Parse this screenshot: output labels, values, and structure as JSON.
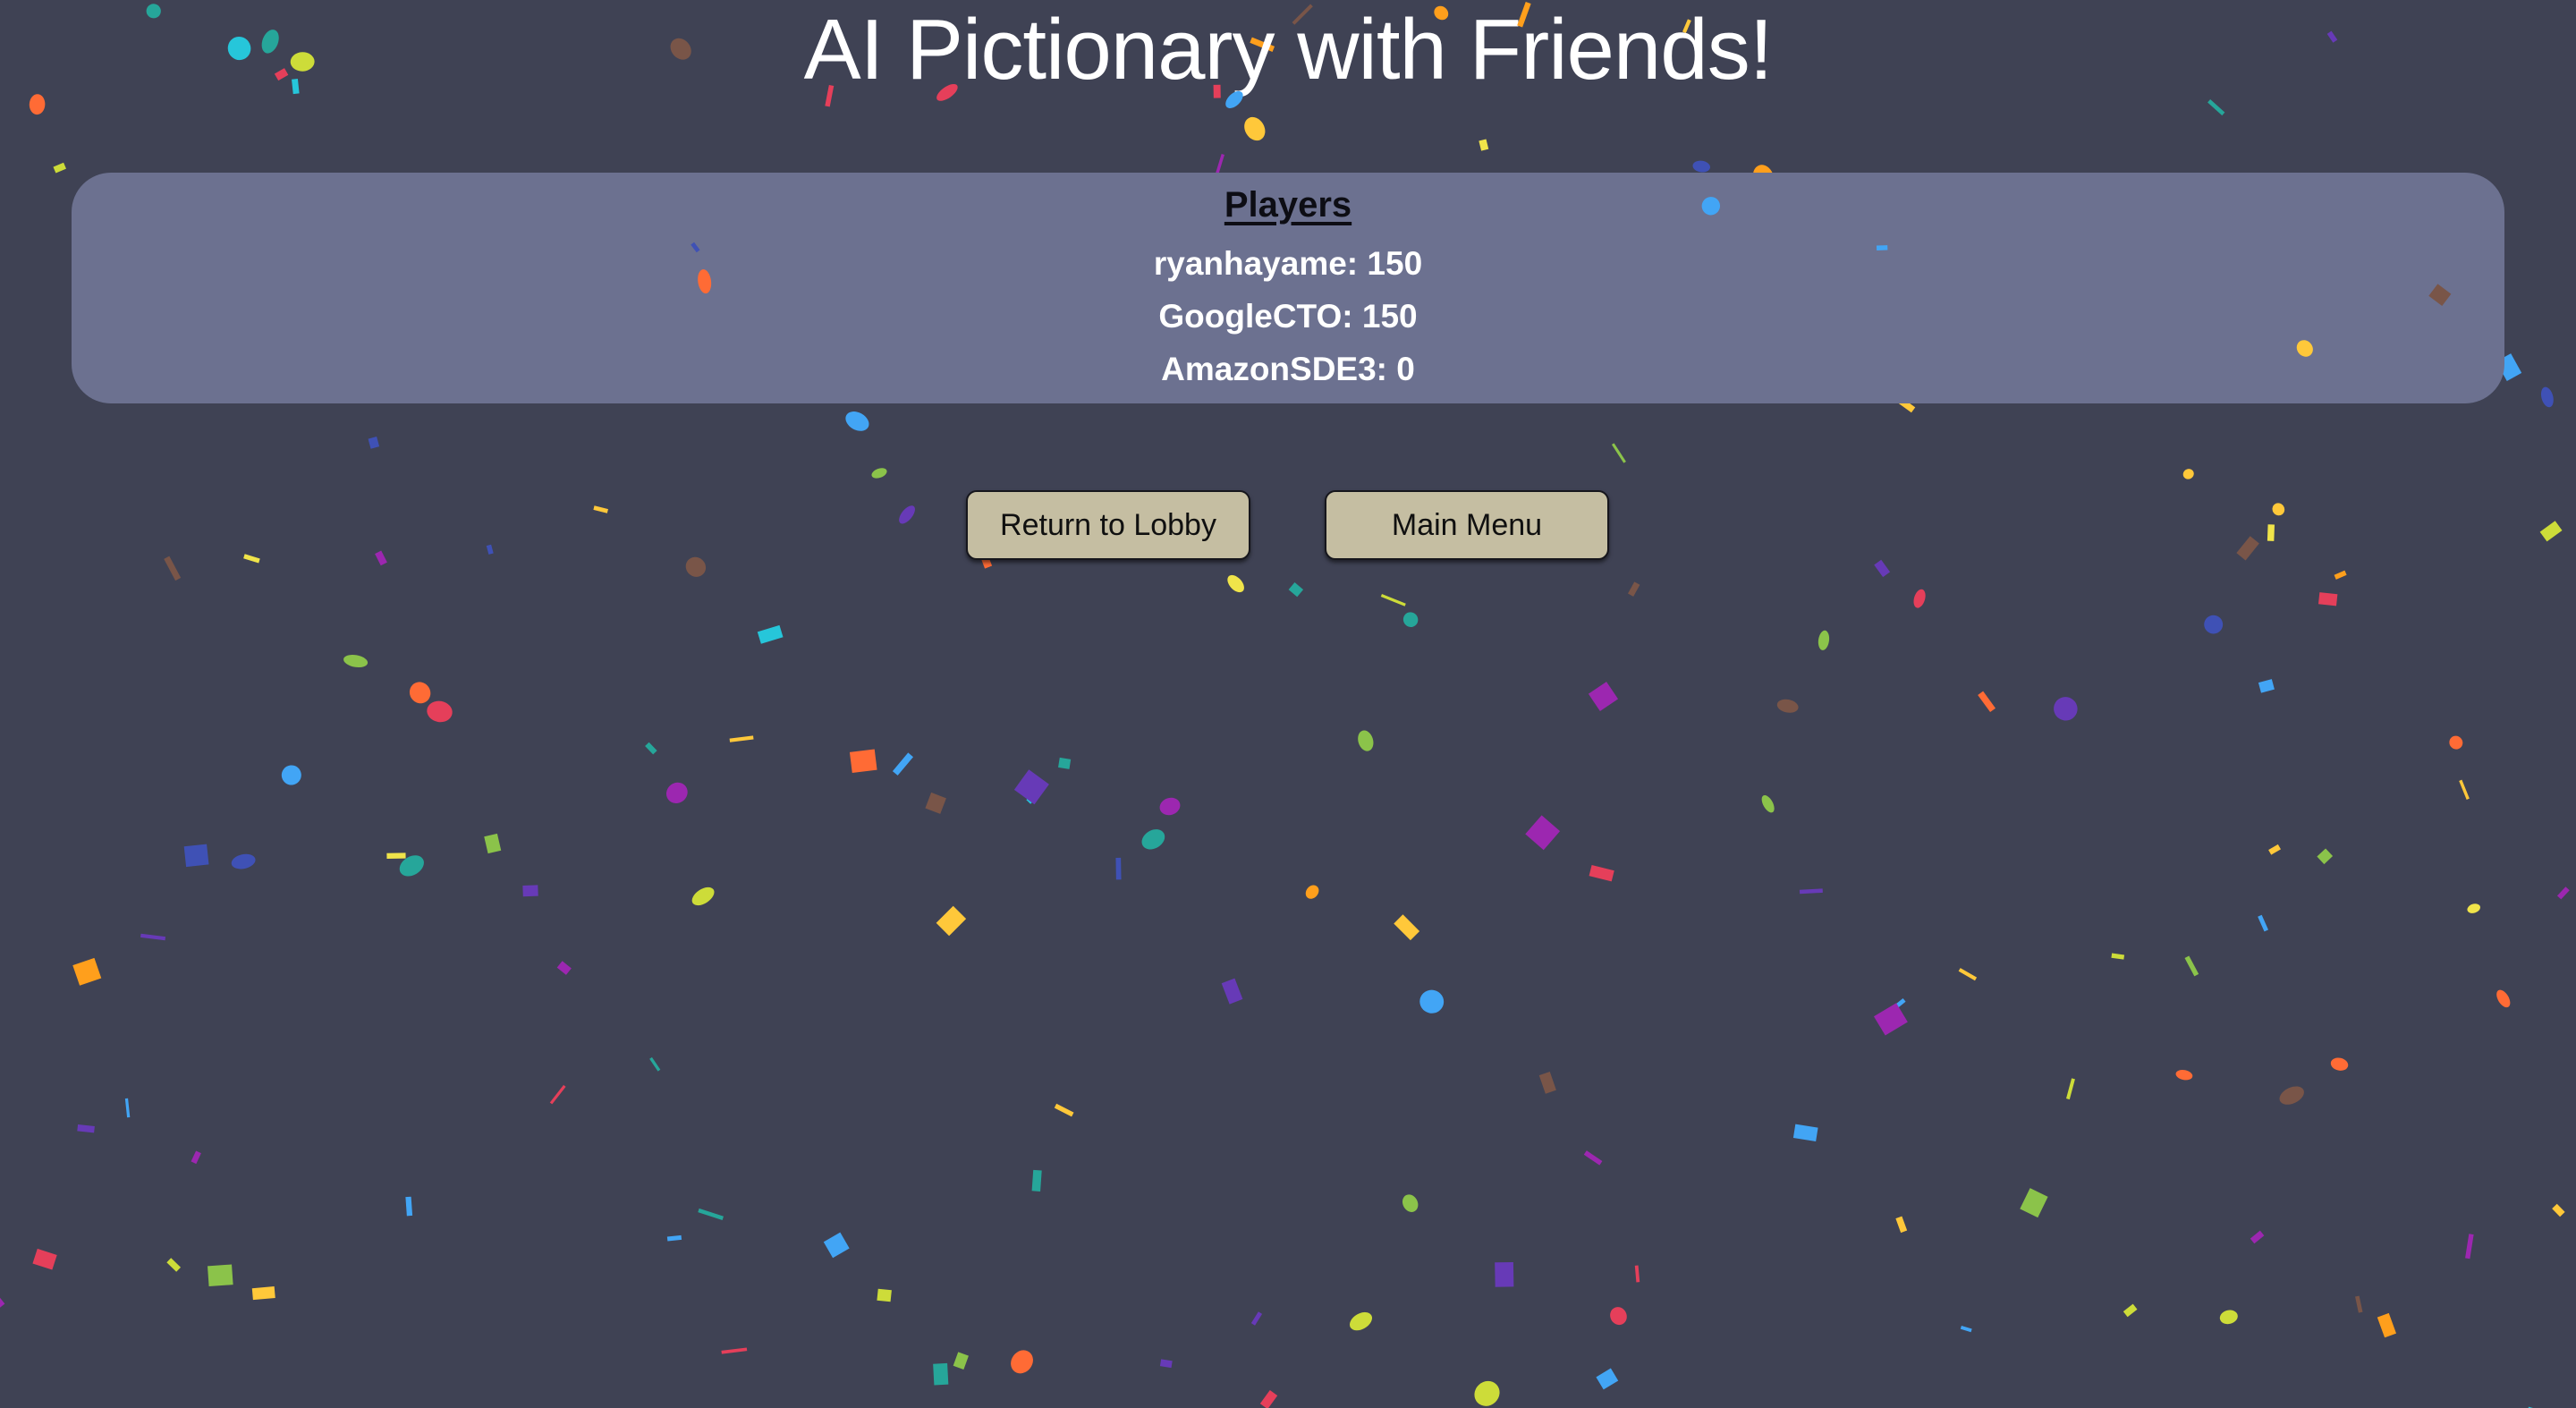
{
  "title": "AI Pictionary with Friends!",
  "scoreboard": {
    "heading": "Players",
    "players": [
      "ryanhayame: 150",
      "GoogleCTO: 150",
      "AmazonSDE3: 0"
    ]
  },
  "buttons": {
    "return_to_lobby": "Return to Lobby",
    "main_menu": "Main Menu"
  },
  "colors": {
    "background": "#3f4254",
    "panel": "#6c7190",
    "button": "#c5bea2",
    "confetti": [
      "#f0e44a",
      "#ffc83a",
      "#ff6b35",
      "#e53f5a",
      "#9c27b0",
      "#673ab7",
      "#3f51b5",
      "#42a5f5",
      "#26c6da",
      "#26a69a",
      "#8bc34a",
      "#cddc39",
      "#795548",
      "#ff9f1c"
    ]
  }
}
